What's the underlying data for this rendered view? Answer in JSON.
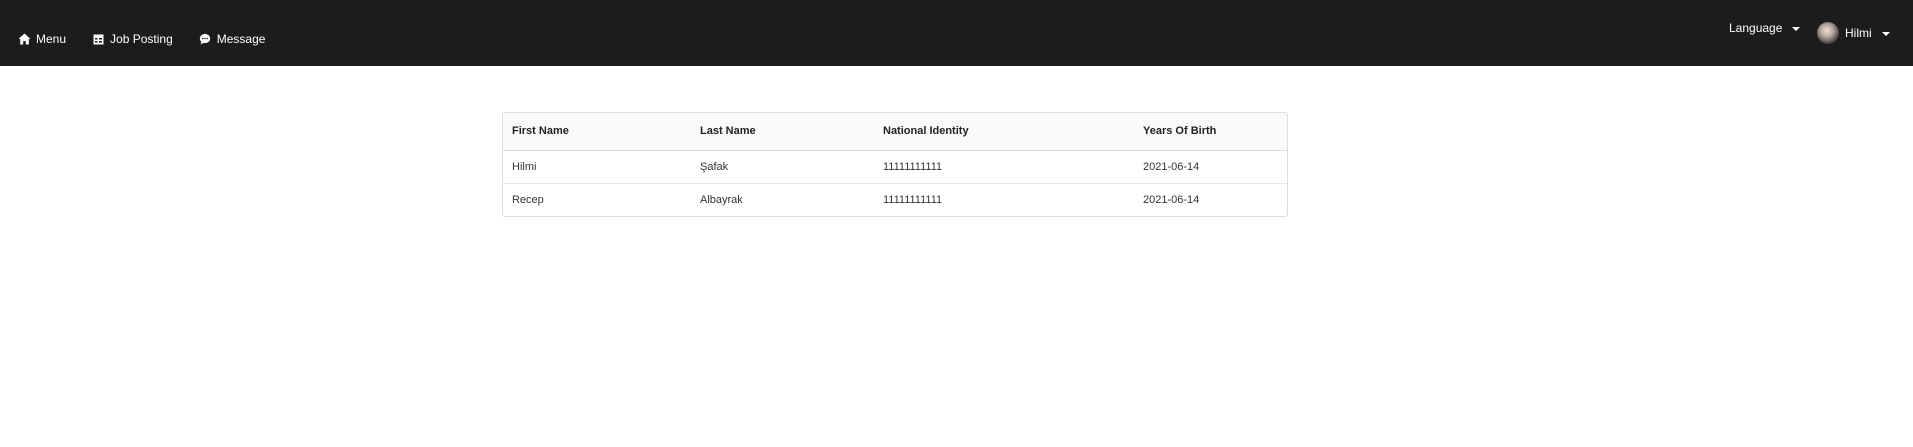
{
  "navbar": {
    "items": [
      {
        "label": "Menu",
        "icon": "home-icon"
      },
      {
        "label": "Job Posting",
        "icon": "table-icon"
      },
      {
        "label": "Message",
        "icon": "comment-icon"
      }
    ],
    "language_label": "Language",
    "user_name": "Hilmi"
  },
  "table": {
    "headers": [
      "First Name",
      "Last Name",
      "National Identity",
      "Years Of Birth"
    ],
    "rows": [
      [
        "Hilmi",
        "Şafak",
        "11111111111",
        "2021-06-14"
      ],
      [
        "Recep",
        "Albayrak",
        "11111111111",
        "2021-06-14"
      ]
    ]
  },
  "colors": {
    "navbar_bg": "#1b1c1d",
    "text_light": "#ffffff",
    "table_header_bg": "#f9fafb"
  }
}
